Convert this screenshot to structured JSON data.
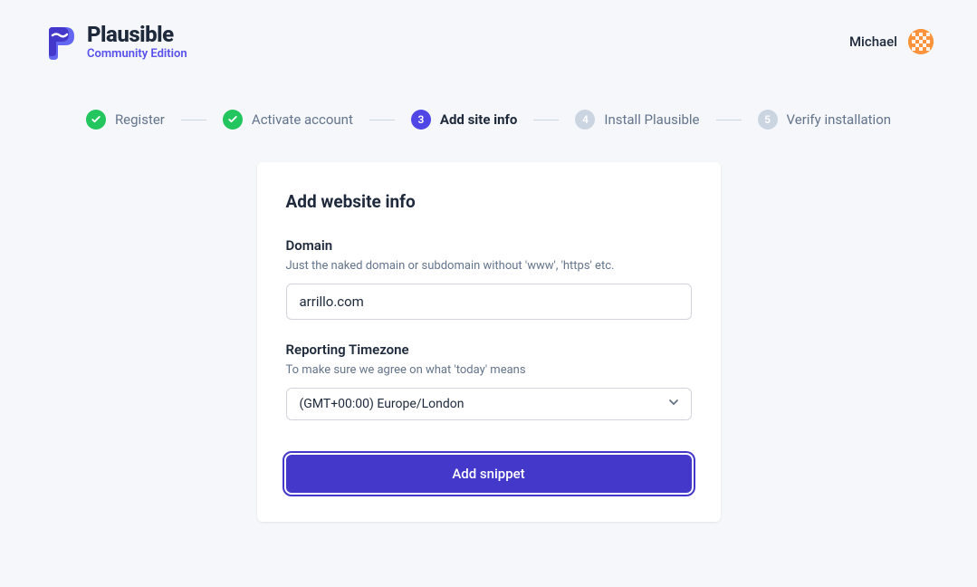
{
  "header": {
    "logo_name": "Plausible",
    "logo_sub": "Community Edition",
    "user_name": "Michael"
  },
  "stepper": {
    "steps": [
      {
        "label": "Register",
        "state": "done"
      },
      {
        "label": "Activate account",
        "state": "done"
      },
      {
        "label": "Add site info",
        "state": "active",
        "num": "3"
      },
      {
        "label": "Install Plausible",
        "state": "pending",
        "num": "4"
      },
      {
        "label": "Verify installation",
        "state": "pending",
        "num": "5"
      }
    ]
  },
  "card": {
    "title": "Add website info",
    "domain": {
      "label": "Domain",
      "hint": "Just the naked domain or subdomain without 'www', 'https' etc.",
      "value": "arrillo.com"
    },
    "timezone": {
      "label": "Reporting Timezone",
      "hint": "To make sure we agree on what 'today' means",
      "value": "(GMT+00:00) Europe/London"
    },
    "submit_label": "Add snippet"
  }
}
